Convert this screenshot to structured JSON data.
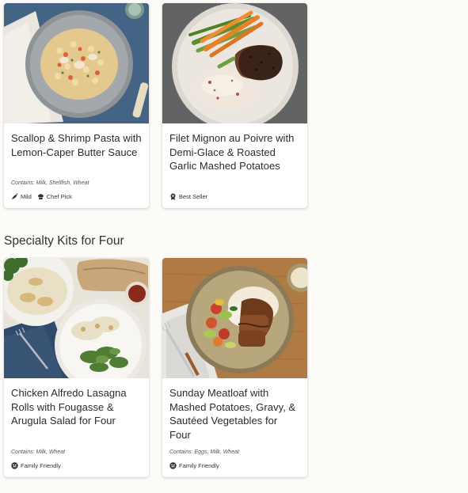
{
  "sections": [
    {
      "title": "",
      "cards": [
        {
          "title": "Scallop & Shrimp Pasta with Lemon-Caper Butter Sauce",
          "contains": "Contains: Milk, Shellfish, Wheat",
          "tags": [
            {
              "icon": "pepper-icon",
              "label": "Mild"
            },
            {
              "icon": "chef-hat-icon",
              "label": "Chef Pick"
            }
          ]
        },
        {
          "title": "Filet Mignon au Poivre with Demi-Glace & Roasted Garlic Mashed Potatoes",
          "contains": "",
          "tags": [
            {
              "icon": "ribbon-icon",
              "label": "Best Seller"
            }
          ]
        }
      ]
    },
    {
      "title": "Specialty Kits for Four",
      "cards": [
        {
          "title": "Chicken Alfredo Lasagna Rolls with Fougasse & Arugula Salad for Four",
          "contains": "Contains: Milk, Wheat",
          "tags": [
            {
              "icon": "family-icon",
              "label": "Family Friendly"
            }
          ]
        },
        {
          "title": "Sunday Meatloaf with Mashed Potatoes, Gravy, & Sautéed Vegetables for Four",
          "contains": "Contains: Eggs, Milk, Wheat",
          "tags": [
            {
              "icon": "family-icon",
              "label": "Family Friendly"
            }
          ]
        }
      ]
    }
  ]
}
